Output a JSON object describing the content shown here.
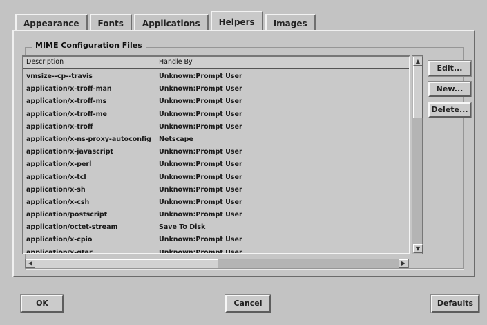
{
  "tabs": [
    {
      "label": "Appearance",
      "active": false
    },
    {
      "label": "Fonts",
      "active": false
    },
    {
      "label": "Applications",
      "active": false
    },
    {
      "label": "Helpers",
      "active": true
    },
    {
      "label": "Images",
      "active": false
    }
  ],
  "group_title": "MIME Configuration Files",
  "list": {
    "headers": [
      "Description",
      "Handle By"
    ],
    "rows": [
      [
        "vmsize--cp--travis",
        "Unknown:Prompt User"
      ],
      [
        "application/x-troff-man",
        "Unknown:Prompt User"
      ],
      [
        "application/x-troff-ms",
        "Unknown:Prompt User"
      ],
      [
        "application/x-troff-me",
        "Unknown:Prompt User"
      ],
      [
        "application/x-troff",
        "Unknown:Prompt User"
      ],
      [
        "application/x-ns-proxy-autoconfig",
        "Netscape"
      ],
      [
        "application/x-javascript",
        "Unknown:Prompt User"
      ],
      [
        "application/x-perl",
        "Unknown:Prompt User"
      ],
      [
        "application/x-tcl",
        "Unknown:Prompt User"
      ],
      [
        "application/x-sh",
        "Unknown:Prompt User"
      ],
      [
        "application/x-csh",
        "Unknown:Prompt User"
      ],
      [
        "application/postscript",
        "Unknown:Prompt User"
      ],
      [
        "application/octet-stream",
        "Save To Disk"
      ],
      [
        "application/x-cpio",
        "Unknown:Prompt User"
      ],
      [
        "application/x-gtar",
        "Unknown:Prompt User"
      ]
    ]
  },
  "side_buttons": {
    "edit": "Edit...",
    "new": "New...",
    "delete": "Delete..."
  },
  "bottom_buttons": {
    "ok": "OK",
    "cancel": "Cancel",
    "defaults": "Defaults"
  },
  "scroll": {
    "vertical_position": 0.05,
    "horizontal_position": 0.0
  }
}
